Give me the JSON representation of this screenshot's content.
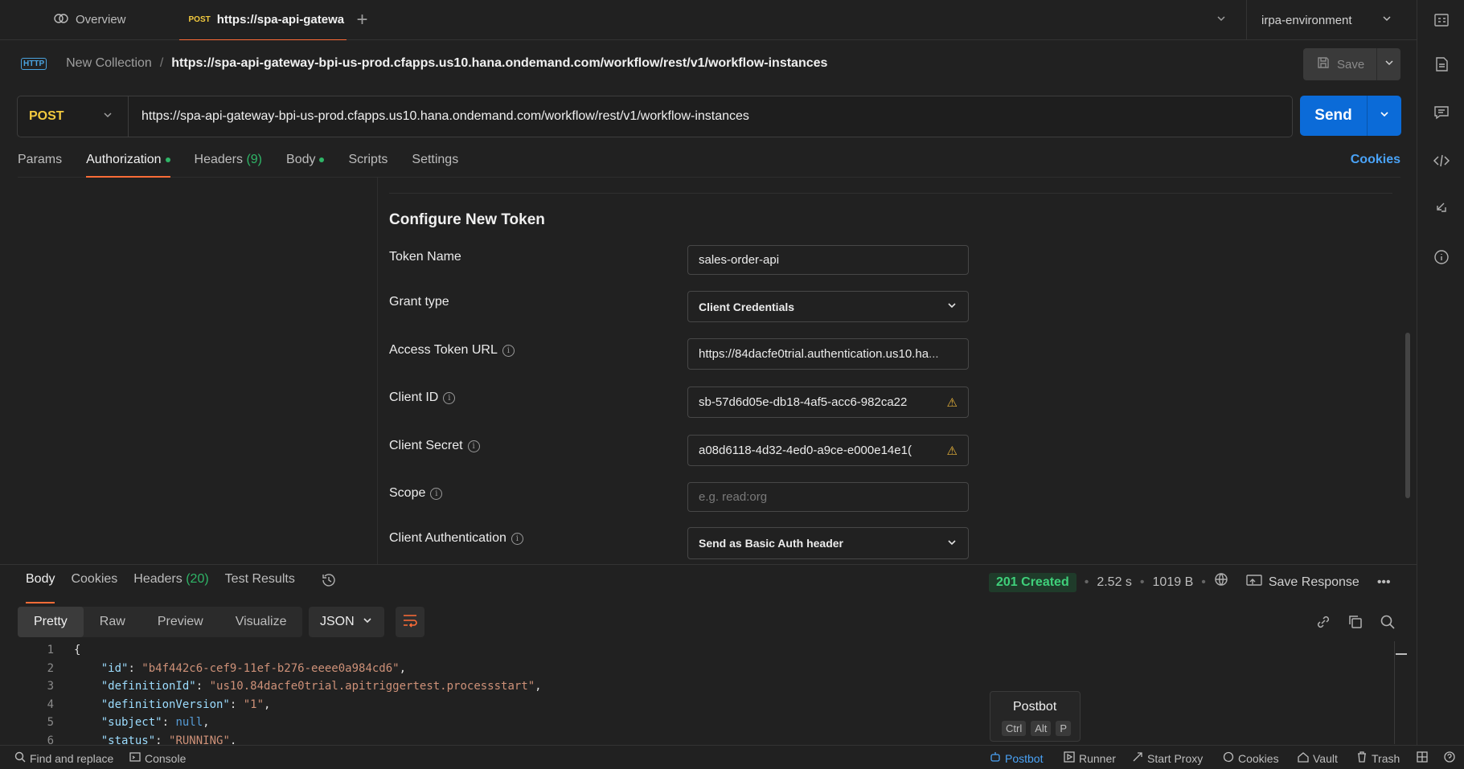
{
  "tabs": {
    "overview_label": "Overview",
    "request_method": "POST",
    "request_label": "https://spa-api-gatewa"
  },
  "environment": {
    "selected": "irpa-environment"
  },
  "breadcrumb": {
    "collection": "New Collection",
    "separator": "/",
    "request_url": "https://spa-api-gateway-bpi-us-prod.cfapps.us10.hana.ondemand.com/workflow/rest/v1/workflow-instances",
    "http_badge": "HTTP"
  },
  "toolbar": {
    "save_label": "Save",
    "send_label": "Send"
  },
  "request": {
    "method": "POST",
    "url": "https://spa-api-gateway-bpi-us-prod.cfapps.us10.hana.ondemand.com/workflow/rest/v1/workflow-instances"
  },
  "request_tabs": {
    "params": "Params",
    "authorization": "Authorization",
    "headers": "Headers",
    "headers_count": "(9)",
    "body": "Body",
    "scripts": "Scripts",
    "settings": "Settings",
    "cookies": "Cookies"
  },
  "auth": {
    "title": "Configure New Token",
    "token_name_label": "Token Name",
    "token_name_value": "sales-order-api",
    "grant_type_label": "Grant type",
    "grant_type_value": "Client Credentials",
    "access_token_url_label": "Access Token URL",
    "access_token_url_value": "https://84dacfe0trial.authentication.us10.ha",
    "access_token_url_ellipsis": "...",
    "client_id_label": "Client ID",
    "client_id_value": "sb-57d6d05e-db18-4af5-acc6-982ca22",
    "client_secret_label": "Client Secret",
    "client_secret_value": "a08d6118-4d32-4ed0-a9ce-e000e14e1(",
    "scope_label": "Scope",
    "scope_placeholder": "e.g. read:org",
    "client_auth_label": "Client Authentication",
    "client_auth_value": "Send as Basic Auth header"
  },
  "response": {
    "tabs": {
      "body": "Body",
      "cookies": "Cookies",
      "headers": "Headers",
      "headers_count": "(20)",
      "test_results": "Test Results"
    },
    "status": "201 Created",
    "time": "2.52 s",
    "size": "1019 B",
    "save_response": "Save Response",
    "more": "•••",
    "views": {
      "pretty": "Pretty",
      "raw": "Raw",
      "preview": "Preview",
      "visualize": "Visualize"
    },
    "format": "JSON",
    "code_lines": [
      {
        "n": "1",
        "key": "",
        "value": "",
        "raw": "{"
      },
      {
        "n": "2",
        "key": "\"id\"",
        "value": "\"b4f442c6-cef9-11ef-b276-eeee0a984cd6\"",
        "type": "string"
      },
      {
        "n": "3",
        "key": "\"definitionId\"",
        "value": "\"us10.84dacfe0trial.apitriggertest.processstart\"",
        "type": "string"
      },
      {
        "n": "4",
        "key": "\"definitionVersion\"",
        "value": "\"1\"",
        "type": "string"
      },
      {
        "n": "5",
        "key": "\"subject\"",
        "value": "null",
        "type": "null"
      },
      {
        "n": "6",
        "key": "\"status\"",
        "value": "\"RUNNING\"",
        "type": "string"
      }
    ]
  },
  "postbot_popup": {
    "title": "Postbot",
    "keys": [
      "Ctrl",
      "Alt",
      "P"
    ]
  },
  "statusbar": {
    "find_replace": "Find and replace",
    "console": "Console",
    "postbot": "Postbot",
    "runner": "Runner",
    "start_proxy": "Start Proxy",
    "cookies": "Cookies",
    "vault": "Vault",
    "trash": "Trash"
  },
  "colors": {
    "accent": "#ff6c37",
    "send": "#0b6bd8",
    "method_post": "#f3ca3e",
    "status_ok": "#3fd07a"
  }
}
